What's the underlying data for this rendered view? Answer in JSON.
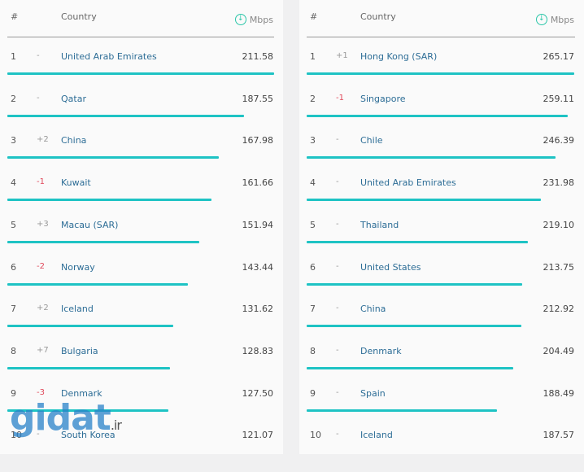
{
  "header": {
    "rank": "#",
    "country": "Country",
    "unit": "Mbps",
    "unit_icon": "download-icon"
  },
  "accent_color": "#1ec3c4",
  "left": {
    "rows": [
      {
        "rank": "1",
        "change": "-",
        "country": "United Arab Emirates",
        "mbps": "211.58"
      },
      {
        "rank": "2",
        "change": "-",
        "country": "Qatar",
        "mbps": "187.55"
      },
      {
        "rank": "3",
        "change": "+2",
        "country": "China",
        "mbps": "167.98"
      },
      {
        "rank": "4",
        "change": "-1",
        "country": "Kuwait",
        "mbps": "161.66"
      },
      {
        "rank": "5",
        "change": "+3",
        "country": "Macau (SAR)",
        "mbps": "151.94"
      },
      {
        "rank": "6",
        "change": "-2",
        "country": "Norway",
        "mbps": "143.44"
      },
      {
        "rank": "7",
        "change": "+2",
        "country": "Iceland",
        "mbps": "131.62"
      },
      {
        "rank": "8",
        "change": "+7",
        "country": "Bulgaria",
        "mbps": "128.83"
      },
      {
        "rank": "9",
        "change": "-3",
        "country": "Denmark",
        "mbps": "127.50"
      },
      {
        "rank": "10",
        "change": "-",
        "country": "South Korea",
        "mbps": "121.07"
      }
    ]
  },
  "right": {
    "rows": [
      {
        "rank": "1",
        "change": "+1",
        "country": "Hong Kong (SAR)",
        "mbps": "265.17"
      },
      {
        "rank": "2",
        "change": "-1",
        "country": "Singapore",
        "mbps": "259.11"
      },
      {
        "rank": "3",
        "change": "-",
        "country": "Chile",
        "mbps": "246.39"
      },
      {
        "rank": "4",
        "change": "-",
        "country": "United Arab Emirates",
        "mbps": "231.98"
      },
      {
        "rank": "5",
        "change": "-",
        "country": "Thailand",
        "mbps": "219.10"
      },
      {
        "rank": "6",
        "change": "-",
        "country": "United States",
        "mbps": "213.75"
      },
      {
        "rank": "7",
        "change": "-",
        "country": "China",
        "mbps": "212.92"
      },
      {
        "rank": "8",
        "change": "-",
        "country": "Denmark",
        "mbps": "204.49"
      },
      {
        "rank": "9",
        "change": "-",
        "country": "Spain",
        "mbps": "188.49"
      },
      {
        "rank": "10",
        "change": "-",
        "country": "Iceland",
        "mbps": "187.57"
      }
    ]
  },
  "watermark": {
    "text": "gidat",
    ".ir": ".ir"
  }
}
